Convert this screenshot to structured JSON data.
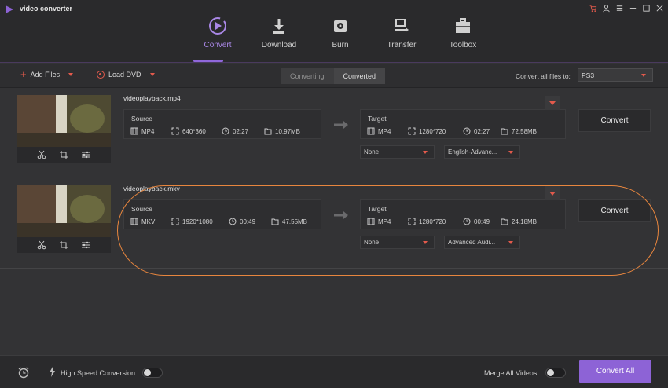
{
  "app": {
    "title": "video converter"
  },
  "nav": {
    "items": [
      {
        "label": "Convert",
        "icon": "convert-icon",
        "active": true
      },
      {
        "label": "Download",
        "icon": "download-icon",
        "active": false
      },
      {
        "label": "Burn",
        "icon": "burn-icon",
        "active": false
      },
      {
        "label": "Transfer",
        "icon": "transfer-icon",
        "active": false
      },
      {
        "label": "Toolbox",
        "icon": "toolbox-icon",
        "active": false
      }
    ]
  },
  "toolbar": {
    "add_files": "Add Files",
    "load_dvd": "Load DVD",
    "tab_converting": "Converting",
    "tab_converted": "Converted",
    "convert_all_to_label": "Convert all files to:",
    "convert_all_to_value": "PS3"
  },
  "files": [
    {
      "name": "videoplayback.mp4",
      "source": {
        "label": "Source",
        "format": "MP4",
        "resolution": "640*360",
        "duration": "02:27",
        "size": "10.97MB"
      },
      "target": {
        "label": "Target",
        "format": "MP4",
        "resolution": "1280*720",
        "duration": "02:27",
        "size": "72.58MB"
      },
      "subtitle": "None",
      "audio": "English-Advanc...",
      "convert_label": "Convert"
    },
    {
      "name": "videoplayback.mkv",
      "source": {
        "label": "Source",
        "format": "MKV",
        "resolution": "1920*1080",
        "duration": "00:49",
        "size": "47.55MB"
      },
      "target": {
        "label": "Target",
        "format": "MP4",
        "resolution": "1280*720",
        "duration": "00:49",
        "size": "24.18MB"
      },
      "subtitle": "None",
      "audio": "Advanced Audi...",
      "convert_label": "Convert"
    }
  ],
  "bottom": {
    "high_speed_label": "High Speed Conversion",
    "merge_label": "Merge All Videos",
    "convert_all_label": "Convert All"
  },
  "colors": {
    "accent": "#8d63d6",
    "red": "#e35a4c",
    "highlight": "#e8863e"
  }
}
